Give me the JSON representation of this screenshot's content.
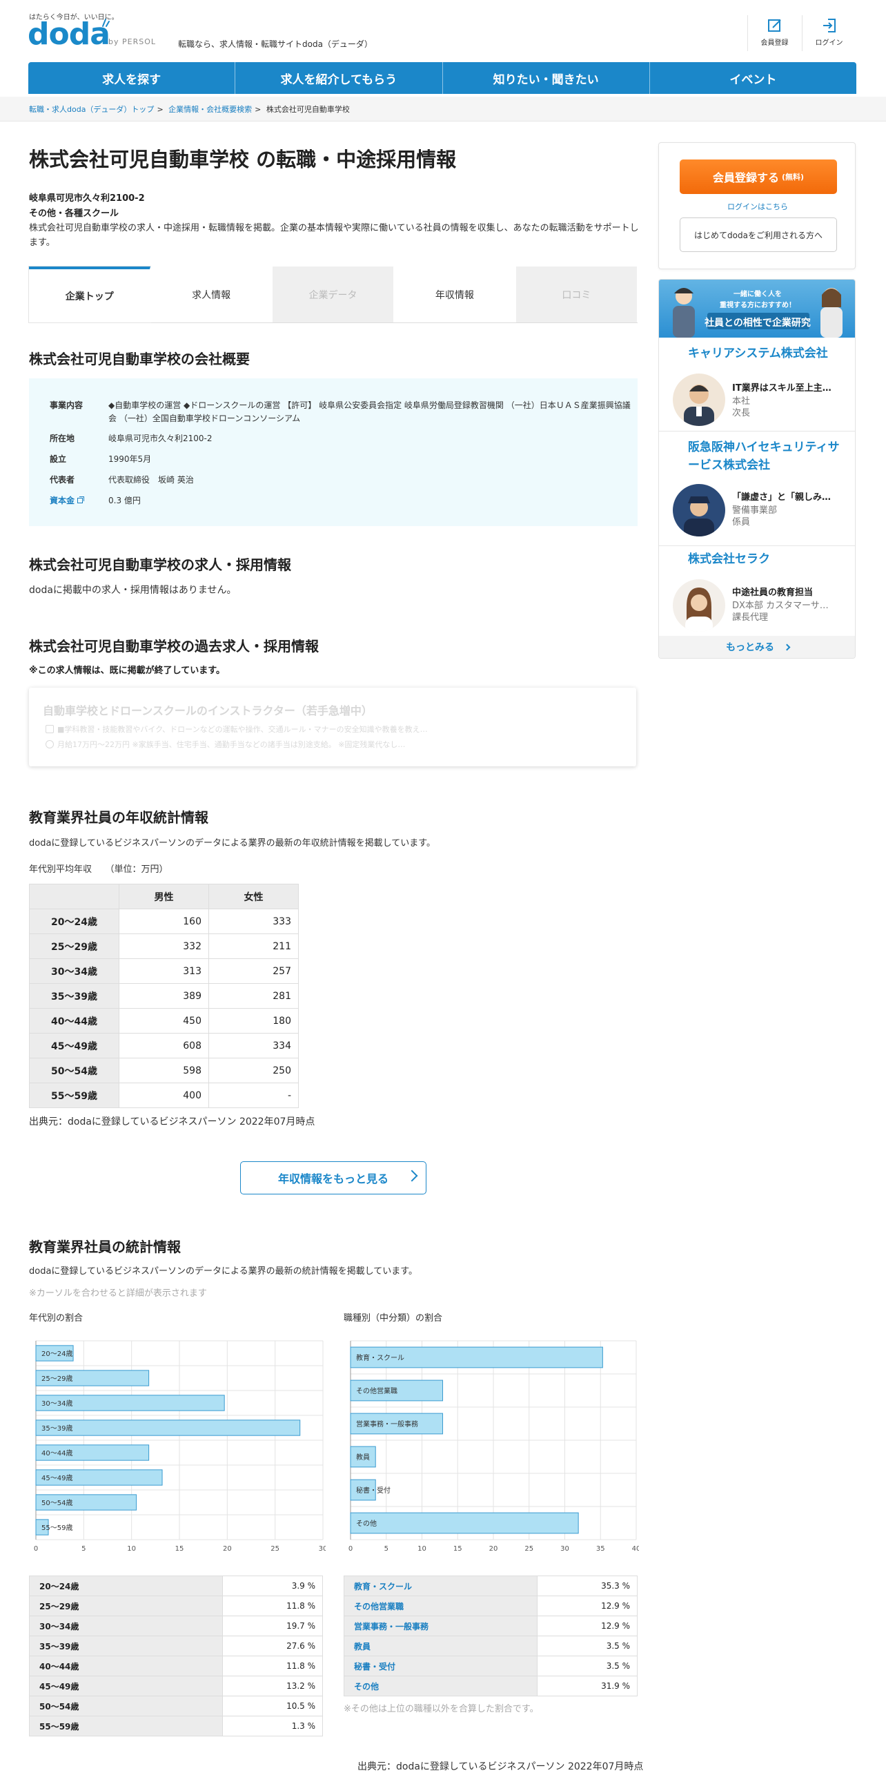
{
  "header": {
    "tagline": "はたらく今日が、いい日に。",
    "logo": "doda",
    "persol": "by PERSOL",
    "description": "転職なら、求人情報・転職サイトdoda（デューダ）",
    "register_label": "会員登録",
    "login_label": "ログイン"
  },
  "nav": [
    "求人を探す",
    "求人を紹介してもらう",
    "知りたい・聞きたい",
    "イベント"
  ],
  "breadcrumb": [
    "転職・求人doda（デューダ）トップ",
    "企業情報・会社概要検索",
    "株式会社可児自動車学校"
  ],
  "company": {
    "title": "株式会社可児自動車学校 の転職・中途採用情報",
    "address": "岐阜県可児市久々利2100-2",
    "industry": "その他・各種スクール",
    "intro": "株式会社可児自動車学校の求人・中途採用・転職情報を掲載。企業の基本情報や実際に働いている社員の情報を収集し、あなたの転職活動をサポートします。"
  },
  "tabs": [
    "企業トップ",
    "求人情報",
    "企業データ",
    "年収情報",
    "口コミ"
  ],
  "overview": {
    "heading": "株式会社可児自動車学校の会社概要",
    "rows": [
      {
        "label": "事業内容",
        "value": "◆自動車学校の運営 ◆ドローンスクールの運営 【許可】 岐阜県公安委員会指定 岐阜県労働局登録教習機関 （一社）日本ＵＡＳ産業振興協議会 （一社）全国自動車学校ドローンコンソーシアム"
      },
      {
        "label": "所在地",
        "value": "岐阜県可児市久々利2100-2"
      },
      {
        "label": "設立",
        "value": "1990年5月"
      },
      {
        "label": "代表者",
        "value": "代表取締役　坂崎 英治"
      },
      {
        "label": "資本金",
        "value": "0.3 億円"
      }
    ]
  },
  "jobs": {
    "heading": "株式会社可児自動車学校の求人・採用情報",
    "text": "dodaに掲載中の求人・採用情報はありません。"
  },
  "past_jobs": {
    "heading": "株式会社可児自動車学校の過去求人・採用情報",
    "note": "※この求人情報は、既に掲載が終了しています。",
    "card_title": "自動車学校とドローンスクールのインストラクター（若手急増中）",
    "line1": "■学科教習・技能教習やバイク、ドローンなどの運転や操作、交通ルール・マナーの安全知識や教養を教え…",
    "line2": "月給17万円～22万円 ※家族手当、住宅手当、通勤手当などの諸手当は別途支給。 ※固定残業代なし…"
  },
  "salary": {
    "heading": "教育業界社員の年収統計情報",
    "desc": "dodaに登録しているビジネスパーソンのデータによる業界の最新の年収統計情報を掲載しています。",
    "caption": "年代別平均年収　　（単位：万円）",
    "columns": [
      "男性",
      "女性"
    ],
    "rows": [
      {
        "age": "20～24歳",
        "male": "160",
        "female": "333"
      },
      {
        "age": "25～29歳",
        "male": "332",
        "female": "211"
      },
      {
        "age": "30～34歳",
        "male": "313",
        "female": "257"
      },
      {
        "age": "35～39歳",
        "male": "389",
        "female": "281"
      },
      {
        "age": "40～44歳",
        "male": "450",
        "female": "180"
      },
      {
        "age": "45～49歳",
        "male": "608",
        "female": "334"
      },
      {
        "age": "50～54歳",
        "male": "598",
        "female": "250"
      },
      {
        "age": "55～59歳",
        "male": "400",
        "female": "-"
      }
    ],
    "source": "出典元：dodaに登録しているビジネスパーソン 2022年07月時点",
    "more_button": "年収情報をもっと見る"
  },
  "stats": {
    "heading": "教育業界社員の統計情報",
    "desc": "dodaに登録しているビジネスパーソンのデータによる業界の最新の統計情報を掲載しています。",
    "hint": "※カーソルを合わせると詳細が表示されます",
    "age_title": "年代別の割合",
    "job_title": "職種別（中分類）の割合",
    "age_table": [
      {
        "label": "20～24歳",
        "value": "3.9 %"
      },
      {
        "label": "25～29歳",
        "value": "11.8 %"
      },
      {
        "label": "30～34歳",
        "value": "19.7 %"
      },
      {
        "label": "35～39歳",
        "value": "27.6 %"
      },
      {
        "label": "40～44歳",
        "value": "11.8 %"
      },
      {
        "label": "45～49歳",
        "value": "13.2 %"
      },
      {
        "label": "50～54歳",
        "value": "10.5 %"
      },
      {
        "label": "55～59歳",
        "value": "1.3 %"
      }
    ],
    "job_table": [
      {
        "label": "教育・スクール",
        "value": "35.3 %"
      },
      {
        "label": "その他営業職",
        "value": "12.9 %"
      },
      {
        "label": "営業事務・一般事務",
        "value": "12.9 %"
      },
      {
        "label": "教員",
        "value": "3.5 %"
      },
      {
        "label": "秘書・受付",
        "value": "3.5 %"
      },
      {
        "label": "その他",
        "value": "31.9 %"
      }
    ],
    "other_note": "※その他は上位の職種以外を合算した割合です。",
    "source": "出典元：dodaに登録しているビジネスパーソン 2022年07月時点"
  },
  "chart_data": [
    {
      "type": "bar",
      "orientation": "horizontal",
      "categories": [
        "20～24歳",
        "25～29歳",
        "30～34歳",
        "35～39歳",
        "40～44歳",
        "45～49歳",
        "50～54歳",
        "55～59歳"
      ],
      "values": [
        3.9,
        11.8,
        19.7,
        27.6,
        11.8,
        13.2,
        10.5,
        1.3
      ],
      "xlim": [
        0,
        30
      ],
      "xticks": [
        0,
        5,
        10,
        15,
        20,
        25,
        30
      ],
      "grid": true
    },
    {
      "type": "bar",
      "orientation": "horizontal",
      "categories": [
        "教育・スクール",
        "その他営業職",
        "営業事務・一般事務",
        "教員",
        "秘書・受付",
        "その他"
      ],
      "values": [
        35.3,
        12.9,
        12.9,
        3.5,
        3.5,
        31.9
      ],
      "xlim": [
        0,
        40
      ],
      "xticks": [
        0,
        5,
        10,
        15,
        20,
        25,
        30,
        35,
        40
      ],
      "grid": true
    }
  ],
  "sidebar": {
    "register_button": "会員登録する",
    "register_free": "(無料)",
    "login_link": "ログインはこちら",
    "first_time_button": "はじめてdodaをご利用される方へ",
    "banner_line1": "一緒に働く人を",
    "banner_line2": "重視する方におすすめ！",
    "banner_title": "社員との相性で企業研究",
    "companies": [
      {
        "name": "キャリアシステム株式会社",
        "employee": "IT業界はスキル至上主…",
        "dept": "本社",
        "role": "次長"
      },
      {
        "name": "阪急阪神ハイセキュリティサービス株式会社",
        "employee": "「謙虚さ」と「親しみ…",
        "dept": "警備事業部",
        "role": "係員"
      },
      {
        "name": "株式会社セラク",
        "employee": "中途社員の教育担当",
        "dept": "DX本部 カスタマーサ…",
        "role": "課長代理"
      }
    ],
    "more_link": "もっとみる"
  },
  "colors": {
    "brand": "#1b87c9",
    "orange": "#f26a0a",
    "bar_fill": "#aee0f4",
    "bar_stroke": "#3a9bd0"
  }
}
